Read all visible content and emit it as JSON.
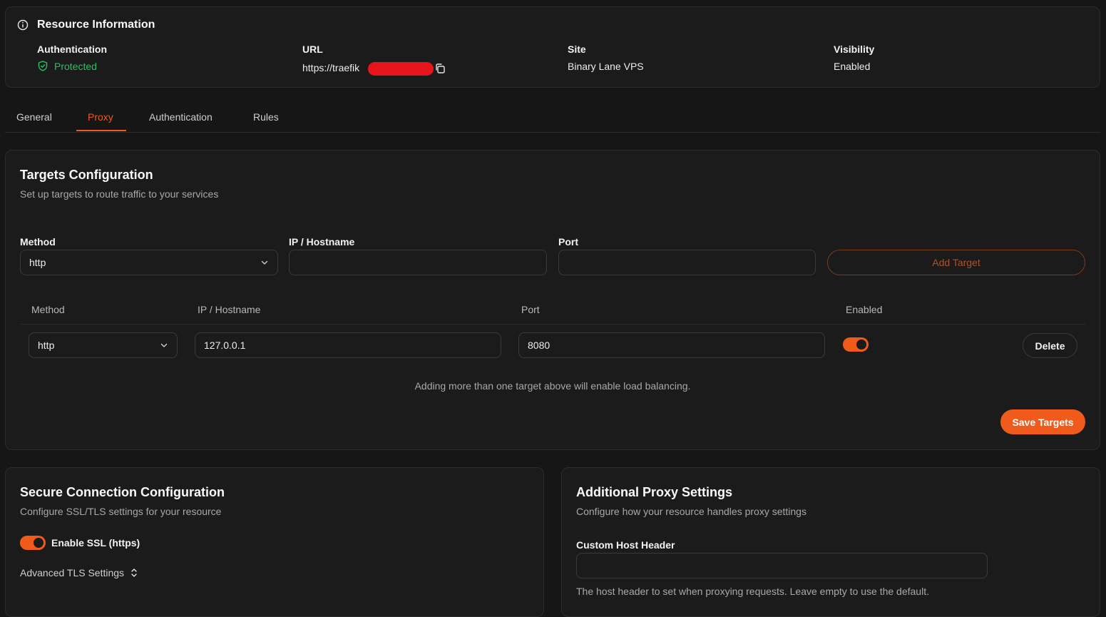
{
  "resource_info": {
    "title": "Resource Information",
    "authentication": {
      "label": "Authentication",
      "value": "Protected"
    },
    "url": {
      "label": "URL",
      "value": "https://traefik"
    },
    "site": {
      "label": "Site",
      "value": "Binary Lane VPS"
    },
    "visibility": {
      "label": "Visibility",
      "value": "Enabled"
    }
  },
  "tabs": [
    {
      "label": "General",
      "active": false
    },
    {
      "label": "Proxy",
      "active": true
    },
    {
      "label": "Authentication",
      "active": false
    },
    {
      "label": "Rules",
      "active": false
    }
  ],
  "targets": {
    "title": "Targets Configuration",
    "subtitle": "Set up targets to route traffic to your services",
    "form": {
      "method_label": "Method",
      "method_value": "http",
      "host_label": "IP / Hostname",
      "host_value": "",
      "port_label": "Port",
      "port_value": "",
      "add_button": "Add Target"
    },
    "table": {
      "headers": [
        "Method",
        "IP / Hostname",
        "Port",
        "Enabled"
      ],
      "rows": [
        {
          "method": "http",
          "host": "127.0.0.1",
          "port": "8080",
          "enabled": true,
          "delete_label": "Delete"
        }
      ]
    },
    "note": "Adding more than one target above will enable load balancing.",
    "save_button": "Save Targets"
  },
  "secure": {
    "title": "Secure Connection Configuration",
    "subtitle": "Configure SSL/TLS settings for your resource",
    "ssl_label": "Enable SSL (https)",
    "ssl_enabled": true,
    "advanced_label": "Advanced TLS Settings"
  },
  "additional": {
    "title": "Additional Proxy Settings",
    "subtitle": "Configure how your resource handles proxy settings",
    "host_header_label": "Custom Host Header",
    "host_header_value": "",
    "host_header_help": "The host header to set when proxying requests. Leave empty to use the default."
  },
  "colors": {
    "accent": "#f05a1a",
    "success": "#22c55e",
    "redaction": "#e8141c"
  }
}
